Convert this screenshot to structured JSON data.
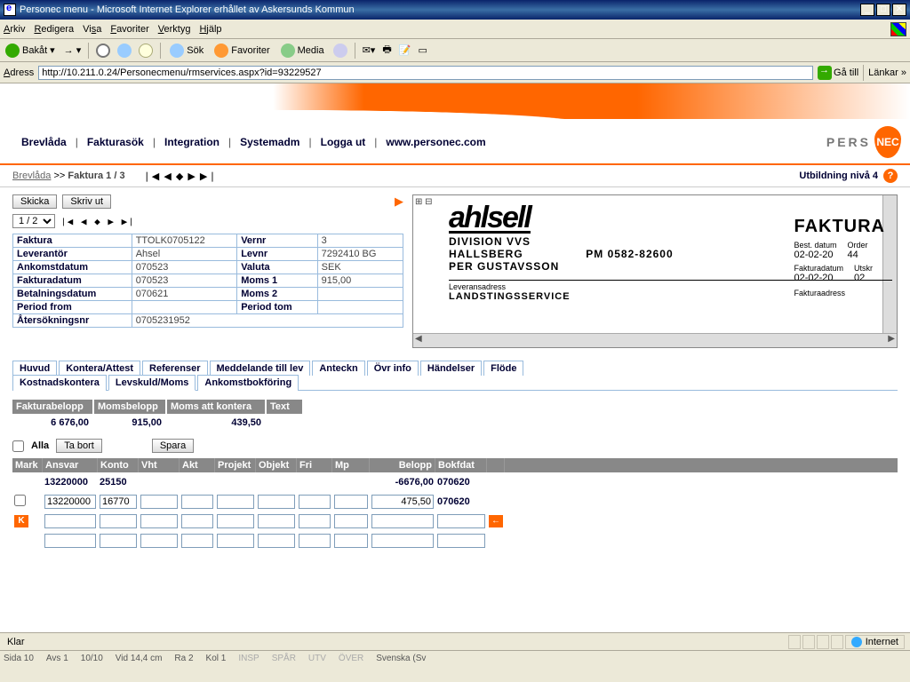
{
  "window": {
    "title": "Personec menu - Microsoft Internet Explorer erhållet av Askersunds Kommun"
  },
  "menubar": {
    "arkiv": "Arkiv",
    "redigera": "Redigera",
    "visa": "Visa",
    "favoriter": "Favoriter",
    "verktyg": "Verktyg",
    "hjalp": "Hjälp"
  },
  "toolbar": {
    "bakat": "Bakåt",
    "sok": "Sök",
    "favoriter": "Favoriter",
    "media": "Media"
  },
  "address": {
    "label": "Adress",
    "url": "http://10.211.0.24/Personecmenu/rmservices.aspx?id=93229527",
    "go": "Gå till",
    "lankar": "Länkar"
  },
  "nav": {
    "brevlada": "Brevlåda",
    "fakturasok": "Fakturasök",
    "integration": "Integration",
    "systemadm": "Systemadm",
    "loggaut": "Logga ut",
    "personec": "www.personec.com",
    "logotext": "PERS",
    "logoshield": "NEC"
  },
  "breadcrumb": {
    "brevlada": "Brevlåda",
    "faktura": "Faktura 1 / 3",
    "pager": "❘◀ ◀ ◆ ▶ ▶❘",
    "rightlabel": "Utbildning nivå 4"
  },
  "buttons": {
    "skicka": "Skicka",
    "skrivut": "Skriv ut",
    "page": "1 / 2",
    "pagearrows": "❘◀ ◀ ◆ ▶ ▶❘",
    "tabort": "Ta bort",
    "spara": "Spara",
    "alla": "Alla"
  },
  "info": {
    "faktura_lbl": "Faktura",
    "faktura_val": "TTOLK0705122",
    "vernr_lbl": "Vernr",
    "vernr_val": "3",
    "lev_lbl": "Leverantör",
    "lev_val": "Ahsel",
    "levnr_lbl": "Levnr",
    "levnr_val": "7292410 BG",
    "ank_lbl": "Ankomstdatum",
    "ank_val": "070523",
    "valuta_lbl": "Valuta",
    "valuta_val": "SEK",
    "fakd_lbl": "Fakturadatum",
    "fakd_val": "070523",
    "moms1_lbl": "Moms 1",
    "moms1_val": "915,00",
    "bet_lbl": "Betalningsdatum",
    "bet_val": "070621",
    "moms2_lbl": "Moms 2",
    "moms2_val": "",
    "pfrom_lbl": "Period from",
    "pfrom_val": "",
    "ptom_lbl": "Period tom",
    "ptom_val": "",
    "ater_lbl": "Återsökningsnr",
    "ater_val": "0705231952"
  },
  "scan": {
    "brand": "ahlsell",
    "division": "DIVISION VVS",
    "city": "HALLSBERG",
    "person": "PER GUSTAVSSON",
    "pm": "PM 0582-82600",
    "levadr": "Leveransadress",
    "landsting": "LANDSTINGSSERVICE",
    "faktura_title": "FAKTURA",
    "best_lbl": "Best. datum",
    "best_val": "02-02-20",
    "order_lbl": "Order",
    "order_val": "44",
    "fakd_lbl": "Fakturadatum",
    "fakd_val": "02-02-20",
    "utskr_lbl": "Utskr",
    "utskr_val": "02",
    "fakadr_lbl": "Fakturaadress"
  },
  "tabs": {
    "huvud": "Huvud",
    "kontera": "Kontera/Attest",
    "referenser": "Referenser",
    "medd": "Meddelande till lev",
    "anteckn": "Anteckn",
    "ovrinfo": "Övr info",
    "handelser": "Händelser",
    "flode": "Flöde",
    "kostnads": "Kostnadskontera",
    "levskuld": "Levskuld/Moms",
    "ankomst": "Ankomstbokföring"
  },
  "summary": {
    "h_fakbel": "Fakturabelopp",
    "h_momsbel": "Momsbelopp",
    "h_momskont": "Moms att kontera",
    "h_text": "Text",
    "v_fakbel": "6 676,00",
    "v_momsbel": "915,00",
    "v_momskont": "439,50",
    "v_text": ""
  },
  "gridhdr": {
    "mark": "Mark",
    "ansvar": "Ansvar",
    "konto": "Konto",
    "vht": "Vht",
    "akt": "Akt",
    "proj": "Projekt",
    "obj": "Objekt",
    "fri": "Fri",
    "mp": "Mp",
    "belopp": "Belopp",
    "bokf": "Bokfdat"
  },
  "row1": {
    "ansvar": "13220000",
    "konto": "25150",
    "belopp": "-6676,00",
    "bokf": "070620"
  },
  "row2": {
    "ansvar": "13220000",
    "konto": "16770",
    "belopp": "475,50",
    "bokf": "070620"
  },
  "status": {
    "klar": "Klar",
    "internet": "Internet"
  },
  "wordbar": {
    "sida": "Sida  10",
    "avs": "Avs  1",
    "tot": "10/10",
    "vid": "Vid  14,4 cm",
    "ra": "Ra  2",
    "kol": "Kol  1",
    "insp": "INSP",
    "spar": "SPÅR",
    "utv": "UTV",
    "over": "ÖVER",
    "lang": "Svenska (Sv"
  }
}
